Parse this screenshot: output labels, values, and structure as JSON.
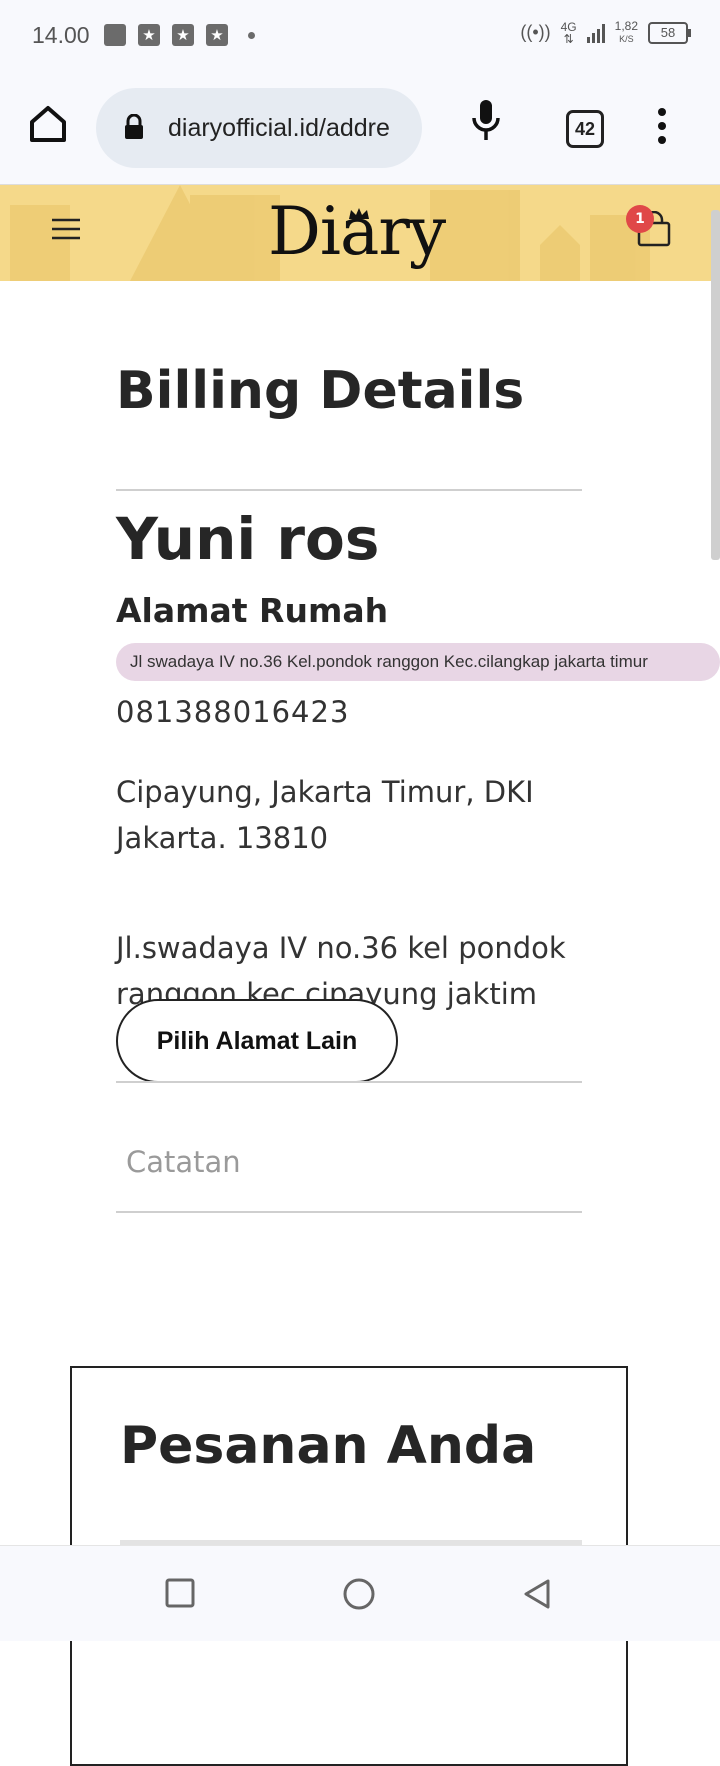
{
  "status_bar": {
    "time": "14.00",
    "network": "4G",
    "speed_value": "1,82",
    "speed_unit": "K/S",
    "battery": "58"
  },
  "browser": {
    "url": "diaryofficial.id/addre",
    "tab_count": "42"
  },
  "header": {
    "logo": "Diary",
    "cart_count": "1"
  },
  "billing": {
    "title": "Billing Details",
    "name": "Yuni ros",
    "address_label": "Alamat Rumah",
    "address_tag": "Jl swadaya IV no.36 Kel.pondok ranggon Kec.cilangkap jakarta timur",
    "phone": "081388016423",
    "region": "Cipayung, Jakarta Timur, DKI Jakarta. 13810",
    "street": "Jl.swadaya IV no.36 kel pondok ranggon kec cipayung jaktim",
    "choose_button": "Pilih Alamat Lain",
    "notes_placeholder": "Catatan"
  },
  "order": {
    "title": "Pesanan Anda"
  },
  "icons": [
    "home-icon",
    "lock-icon",
    "mic-icon",
    "more-vert-icon",
    "hamburger-icon",
    "crown-icon",
    "cart-icon",
    "recents-icon",
    "home-circle-icon",
    "back-icon"
  ]
}
